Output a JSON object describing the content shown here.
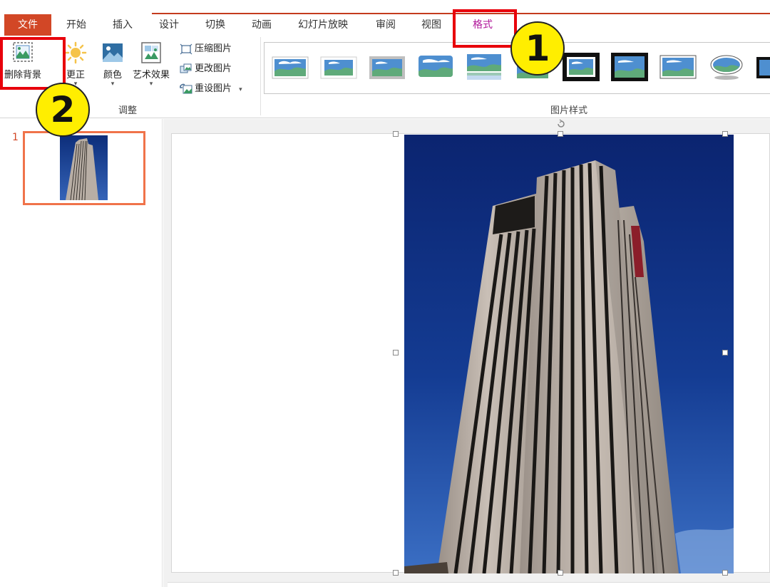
{
  "tabs": {
    "file": "文件",
    "home": "开始",
    "insert": "插入",
    "design": "设计",
    "transitions": "切换",
    "animations": "动画",
    "slideshow": "幻灯片放映",
    "review": "审阅",
    "view": "视图",
    "format": "格式"
  },
  "ribbon": {
    "adjust": {
      "remove_bg": "删除背景",
      "corrections": "更正",
      "color": "颜色",
      "artistic": "艺术效果",
      "compress": "压缩图片",
      "change": "更改图片",
      "reset": "重设图片",
      "group_label": "调整"
    },
    "styles": {
      "group_label": "图片样式"
    }
  },
  "slides": {
    "current_number": "1"
  },
  "callouts": {
    "one": "1",
    "two": "2"
  },
  "colors": {
    "file_tab": "#d24726",
    "active_tab": "#b0179a",
    "callout_box": "#e8000b",
    "callout_badge": "#ffee00",
    "thumb_border": "#f0734a"
  },
  "icons": [
    "remove-background-icon",
    "corrections-icon",
    "color-icon",
    "artistic-effects-icon",
    "compress-pictures-icon",
    "change-picture-icon",
    "reset-picture-icon",
    "dropdown-arrow-icon"
  ]
}
